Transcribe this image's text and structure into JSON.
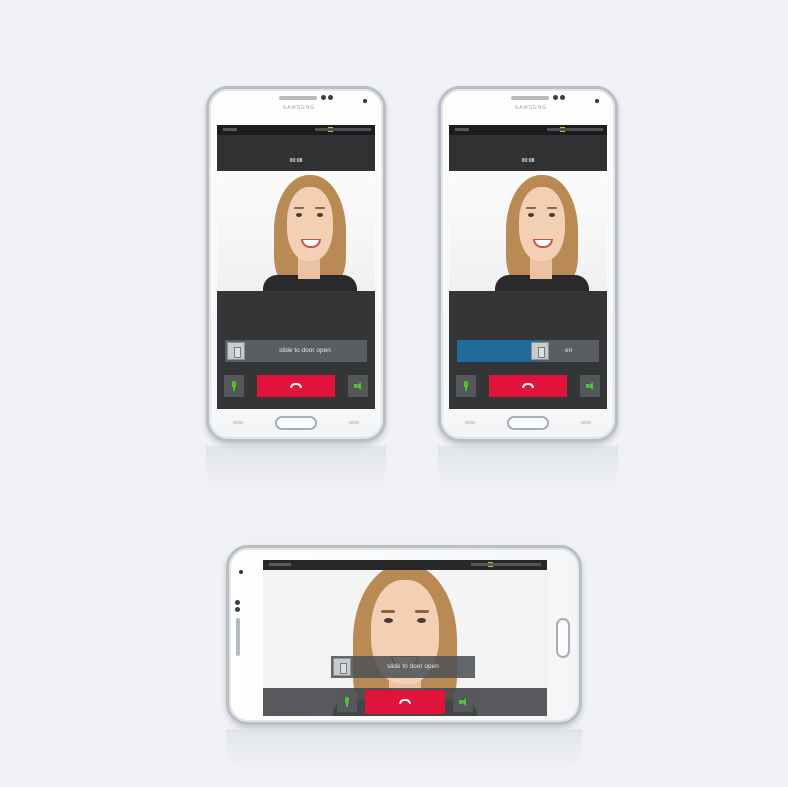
{
  "phones": {
    "brand": "SAMSUNG",
    "portrait_left": {
      "time": "00:08",
      "slider_label": "slide to door open",
      "slider_progress": 0.0
    },
    "portrait_right": {
      "time": "00:08",
      "slider_label": "en",
      "slider_progress": 0.6
    },
    "landscape": {
      "slider_label": "slide to door open",
      "slider_progress": 0.0
    }
  },
  "icons": {
    "door": "door-icon",
    "mic": "microphone-icon",
    "speaker": "speaker-icon",
    "hangup": "hang-up-icon"
  },
  "colors": {
    "hangup": "#e0133a",
    "slider_fill": "#1f6c9c",
    "active_icon": "#52c234",
    "background": "#eff1f4"
  }
}
